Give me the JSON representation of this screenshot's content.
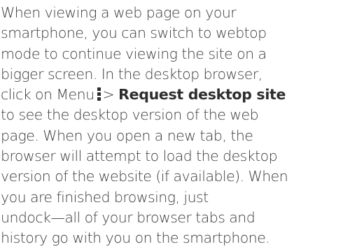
{
  "instructions": {
    "line1": "When viewing a web page on your",
    "line2": "smartphone, you can switch to webtop",
    "line3": "mode to continue viewing the site on a",
    "line4": "bigger screen. In the desktop browser,",
    "line5_before_icon": "click on Menu",
    "menu_icon": "vertical-ellipsis-menu-icon",
    "line5_separator": ">",
    "line5_bold": "Request desktop site",
    "line6": "to see the desktop version of the web",
    "line7": "page. When you open a new tab, the",
    "line8": "browser will attempt to load the desktop",
    "line9": "version of the website (if available). When",
    "line10": "you are finished browsing, just",
    "line11": "undock—all of your browser tabs and",
    "line12": "history go with you on the smartphone."
  },
  "colors": {
    "text": "#3a3a3a",
    "emphasis": "#2e2e2e",
    "background": "#ffffff"
  }
}
